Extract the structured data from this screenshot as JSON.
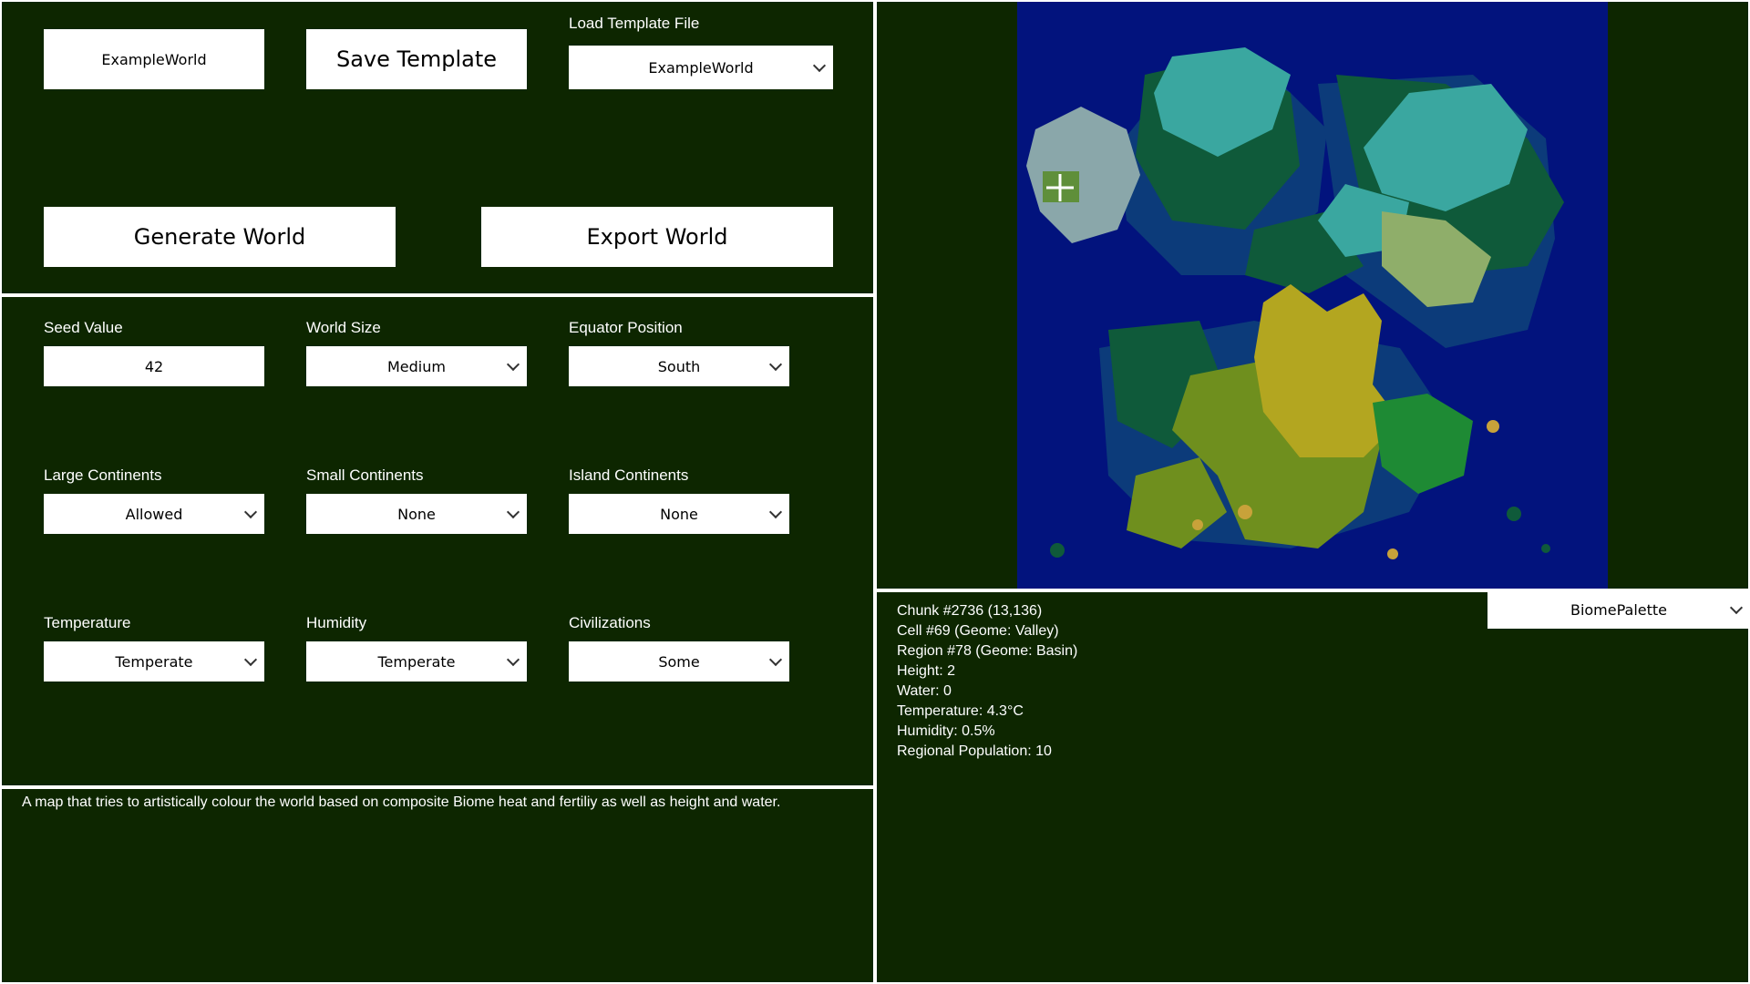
{
  "top": {
    "template_name_value": "ExampleWorld",
    "save_label": "Save Template",
    "load_label": "Load Template File",
    "load_selected": "ExampleWorld",
    "generate_label": "Generate World",
    "export_label": "Export World"
  },
  "settings": {
    "seed": {
      "label": "Seed Value",
      "value": "42"
    },
    "world_size": {
      "label": "World Size",
      "value": "Medium"
    },
    "equator": {
      "label": "Equator Position",
      "value": "South"
    },
    "large_continents": {
      "label": "Large Continents",
      "value": "Allowed"
    },
    "small_continents": {
      "label": "Small Continents",
      "value": "None"
    },
    "island_continents": {
      "label": "Island Continents",
      "value": "None"
    },
    "temperature": {
      "label": "Temperature",
      "value": "Temperate"
    },
    "humidity": {
      "label": "Humidity",
      "value": "Temperate"
    },
    "civilizations": {
      "label": "Civilizations",
      "value": "Some"
    }
  },
  "description": "A map that tries to artistically colour the world based on composite Biome heat and fertiliy as well as height and water.",
  "palette": {
    "selected": "BiomePalette"
  },
  "info": [
    "Chunk #2736 (13,136)",
    "Cell #69 (Geome: Valley)",
    "Region #78 (Geome: Basin)",
    "Height: 2",
    "Water: 0",
    "Temperature: 4.3°C",
    "Humidity: 0.5%",
    "Regional Population: 10"
  ],
  "colors": {
    "panel_bg": "#0d2600",
    "ocean": "#02137d",
    "deep_coast": "#0c3b7a",
    "forest": "#0f5a3a",
    "teal": "#3aa7a0",
    "ice": "#8aa7aa",
    "grass": "#6f8f1e",
    "desert": "#b3a620",
    "jungle": "#1e8a34",
    "sand": "#c8a23a"
  }
}
